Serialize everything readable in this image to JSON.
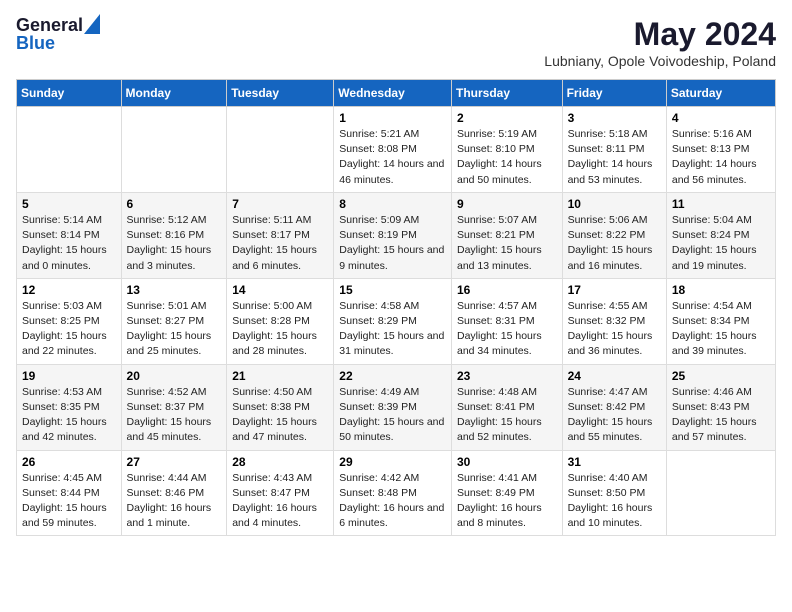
{
  "logo": {
    "general": "General",
    "blue": "Blue"
  },
  "title": "May 2024",
  "location": "Lubniany, Opole Voivodeship, Poland",
  "weekdays": [
    "Sunday",
    "Monday",
    "Tuesday",
    "Wednesday",
    "Thursday",
    "Friday",
    "Saturday"
  ],
  "weeks": [
    [
      {
        "day": "",
        "sunrise": "",
        "sunset": "",
        "daylight": ""
      },
      {
        "day": "",
        "sunrise": "",
        "sunset": "",
        "daylight": ""
      },
      {
        "day": "",
        "sunrise": "",
        "sunset": "",
        "daylight": ""
      },
      {
        "day": "1",
        "sunrise": "Sunrise: 5:21 AM",
        "sunset": "Sunset: 8:08 PM",
        "daylight": "Daylight: 14 hours and 46 minutes."
      },
      {
        "day": "2",
        "sunrise": "Sunrise: 5:19 AM",
        "sunset": "Sunset: 8:10 PM",
        "daylight": "Daylight: 14 hours and 50 minutes."
      },
      {
        "day": "3",
        "sunrise": "Sunrise: 5:18 AM",
        "sunset": "Sunset: 8:11 PM",
        "daylight": "Daylight: 14 hours and 53 minutes."
      },
      {
        "day": "4",
        "sunrise": "Sunrise: 5:16 AM",
        "sunset": "Sunset: 8:13 PM",
        "daylight": "Daylight: 14 hours and 56 minutes."
      }
    ],
    [
      {
        "day": "5",
        "sunrise": "Sunrise: 5:14 AM",
        "sunset": "Sunset: 8:14 PM",
        "daylight": "Daylight: 15 hours and 0 minutes."
      },
      {
        "day": "6",
        "sunrise": "Sunrise: 5:12 AM",
        "sunset": "Sunset: 8:16 PM",
        "daylight": "Daylight: 15 hours and 3 minutes."
      },
      {
        "day": "7",
        "sunrise": "Sunrise: 5:11 AM",
        "sunset": "Sunset: 8:17 PM",
        "daylight": "Daylight: 15 hours and 6 minutes."
      },
      {
        "day": "8",
        "sunrise": "Sunrise: 5:09 AM",
        "sunset": "Sunset: 8:19 PM",
        "daylight": "Daylight: 15 hours and 9 minutes."
      },
      {
        "day": "9",
        "sunrise": "Sunrise: 5:07 AM",
        "sunset": "Sunset: 8:21 PM",
        "daylight": "Daylight: 15 hours and 13 minutes."
      },
      {
        "day": "10",
        "sunrise": "Sunrise: 5:06 AM",
        "sunset": "Sunset: 8:22 PM",
        "daylight": "Daylight: 15 hours and 16 minutes."
      },
      {
        "day": "11",
        "sunrise": "Sunrise: 5:04 AM",
        "sunset": "Sunset: 8:24 PM",
        "daylight": "Daylight: 15 hours and 19 minutes."
      }
    ],
    [
      {
        "day": "12",
        "sunrise": "Sunrise: 5:03 AM",
        "sunset": "Sunset: 8:25 PM",
        "daylight": "Daylight: 15 hours and 22 minutes."
      },
      {
        "day": "13",
        "sunrise": "Sunrise: 5:01 AM",
        "sunset": "Sunset: 8:27 PM",
        "daylight": "Daylight: 15 hours and 25 minutes."
      },
      {
        "day": "14",
        "sunrise": "Sunrise: 5:00 AM",
        "sunset": "Sunset: 8:28 PM",
        "daylight": "Daylight: 15 hours and 28 minutes."
      },
      {
        "day": "15",
        "sunrise": "Sunrise: 4:58 AM",
        "sunset": "Sunset: 8:29 PM",
        "daylight": "Daylight: 15 hours and 31 minutes."
      },
      {
        "day": "16",
        "sunrise": "Sunrise: 4:57 AM",
        "sunset": "Sunset: 8:31 PM",
        "daylight": "Daylight: 15 hours and 34 minutes."
      },
      {
        "day": "17",
        "sunrise": "Sunrise: 4:55 AM",
        "sunset": "Sunset: 8:32 PM",
        "daylight": "Daylight: 15 hours and 36 minutes."
      },
      {
        "day": "18",
        "sunrise": "Sunrise: 4:54 AM",
        "sunset": "Sunset: 8:34 PM",
        "daylight": "Daylight: 15 hours and 39 minutes."
      }
    ],
    [
      {
        "day": "19",
        "sunrise": "Sunrise: 4:53 AM",
        "sunset": "Sunset: 8:35 PM",
        "daylight": "Daylight: 15 hours and 42 minutes."
      },
      {
        "day": "20",
        "sunrise": "Sunrise: 4:52 AM",
        "sunset": "Sunset: 8:37 PM",
        "daylight": "Daylight: 15 hours and 45 minutes."
      },
      {
        "day": "21",
        "sunrise": "Sunrise: 4:50 AM",
        "sunset": "Sunset: 8:38 PM",
        "daylight": "Daylight: 15 hours and 47 minutes."
      },
      {
        "day": "22",
        "sunrise": "Sunrise: 4:49 AM",
        "sunset": "Sunset: 8:39 PM",
        "daylight": "Daylight: 15 hours and 50 minutes."
      },
      {
        "day": "23",
        "sunrise": "Sunrise: 4:48 AM",
        "sunset": "Sunset: 8:41 PM",
        "daylight": "Daylight: 15 hours and 52 minutes."
      },
      {
        "day": "24",
        "sunrise": "Sunrise: 4:47 AM",
        "sunset": "Sunset: 8:42 PM",
        "daylight": "Daylight: 15 hours and 55 minutes."
      },
      {
        "day": "25",
        "sunrise": "Sunrise: 4:46 AM",
        "sunset": "Sunset: 8:43 PM",
        "daylight": "Daylight: 15 hours and 57 minutes."
      }
    ],
    [
      {
        "day": "26",
        "sunrise": "Sunrise: 4:45 AM",
        "sunset": "Sunset: 8:44 PM",
        "daylight": "Daylight: 15 hours and 59 minutes."
      },
      {
        "day": "27",
        "sunrise": "Sunrise: 4:44 AM",
        "sunset": "Sunset: 8:46 PM",
        "daylight": "Daylight: 16 hours and 1 minute."
      },
      {
        "day": "28",
        "sunrise": "Sunrise: 4:43 AM",
        "sunset": "Sunset: 8:47 PM",
        "daylight": "Daylight: 16 hours and 4 minutes."
      },
      {
        "day": "29",
        "sunrise": "Sunrise: 4:42 AM",
        "sunset": "Sunset: 8:48 PM",
        "daylight": "Daylight: 16 hours and 6 minutes."
      },
      {
        "day": "30",
        "sunrise": "Sunrise: 4:41 AM",
        "sunset": "Sunset: 8:49 PM",
        "daylight": "Daylight: 16 hours and 8 minutes."
      },
      {
        "day": "31",
        "sunrise": "Sunrise: 4:40 AM",
        "sunset": "Sunset: 8:50 PM",
        "daylight": "Daylight: 16 hours and 10 minutes."
      },
      {
        "day": "",
        "sunrise": "",
        "sunset": "",
        "daylight": ""
      }
    ]
  ]
}
